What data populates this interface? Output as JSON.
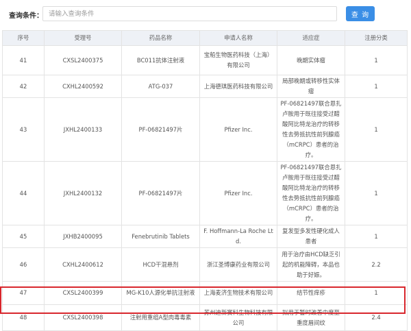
{
  "search": {
    "label": "查询条件：",
    "placeholder": "请输入查询条件",
    "button_label": "查 询"
  },
  "table": {
    "columns": [
      "序号",
      "受理号",
      "药品名称",
      "申请人名称",
      "适应症",
      "注册分类"
    ],
    "rows": [
      [
        "41",
        "CXSL2400375",
        "BC011抗体注射液",
        "宝船生物医药科技（上海）有限公司",
        "晚期实体瘤",
        "1"
      ],
      [
        "42",
        "CXHL2400592",
        "ATG-037",
        "上海德琪医药科技有限公司",
        "局部晚期或转移性实体瘤",
        "1"
      ],
      [
        "43",
        "JXHL2400133",
        "PF-06821497片",
        "Pfizer Inc.",
        "PF-06821497联合恩扎卢胺用于既往接受过醋酸阿比特龙治疗的转移性去势抵抗性前列腺癌（mCRPC）患者的治疗。",
        "1"
      ],
      [
        "44",
        "JXHL2400132",
        "PF-06821497片",
        "Pfizer Inc.",
        "PF-06821497联合恩扎卢胺用于既往接受过醋酸阿比特龙治疗的转移性去势抵抗性前列腺癌（mCRPC）患者的治疗。",
        "1"
      ],
      [
        "45",
        "JXHB2400095",
        "Fenebrutinib Tablets",
        "F. Hoffmann-La Roche Ltd.",
        "复发型多发性硬化成人患者",
        "1"
      ],
      [
        "46",
        "CXHL2400612",
        "HCD干混悬剂",
        "浙江圣博康药业有限公司",
        "用于治疗由HCD缺乏引起的机能障碍，本品也助于好娠。",
        "2.2"
      ],
      [
        "47",
        "CXSL2400399",
        "MG-K10人源化单抗注射液",
        "上海麦济生物技术有限公司",
        "结节性痒疹",
        "1"
      ],
      [
        "48",
        "CXSL2400398",
        "注射用重组A型肉毒毒素",
        "苏州迪新赛科生物科技有限公司",
        "拟用于暂时改善中度至重度眉间纹",
        "2.4"
      ]
    ]
  },
  "colors": {
    "accent": "#3a8ee6",
    "header_bg": "#eef1f6",
    "highlight": "#d8262c"
  }
}
